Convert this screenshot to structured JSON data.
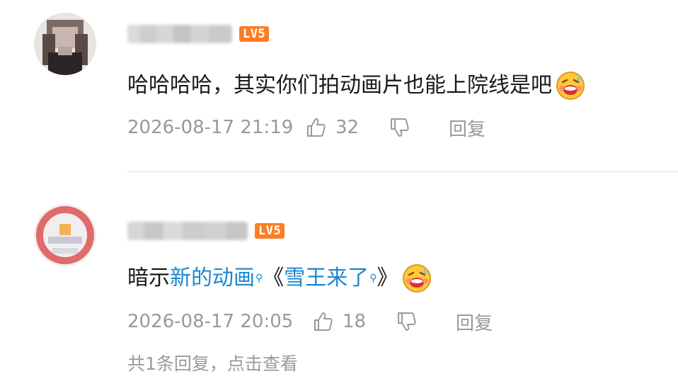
{
  "comments": [
    {
      "level": "LV5",
      "text": "哈哈哈哈，其实你们拍动画片也能上院线是吧",
      "emoji_icon": "sweat-laugh-emoji-icon",
      "time": "2026-08-17 21:19",
      "likes": "32",
      "reply_label": "回复"
    },
    {
      "level": "LV5",
      "text_prefix": "暗示",
      "link1": "新的动画",
      "bracket_open": "《",
      "link2": "雪王来了",
      "bracket_close": "》",
      "emoji_icon": "sweat-laugh-emoji-icon",
      "time": "2026-08-17 20:05",
      "likes": "18",
      "reply_label": "回复",
      "view_replies": "共1条回复，点击查看"
    }
  ],
  "icons": {
    "like": "thumb-up-icon",
    "dislike": "thumb-down-icon",
    "search_link": "search-icon"
  },
  "colors": {
    "link": "#1a87cf",
    "level_badge": "#ff7d24",
    "meta_text": "#999999"
  }
}
